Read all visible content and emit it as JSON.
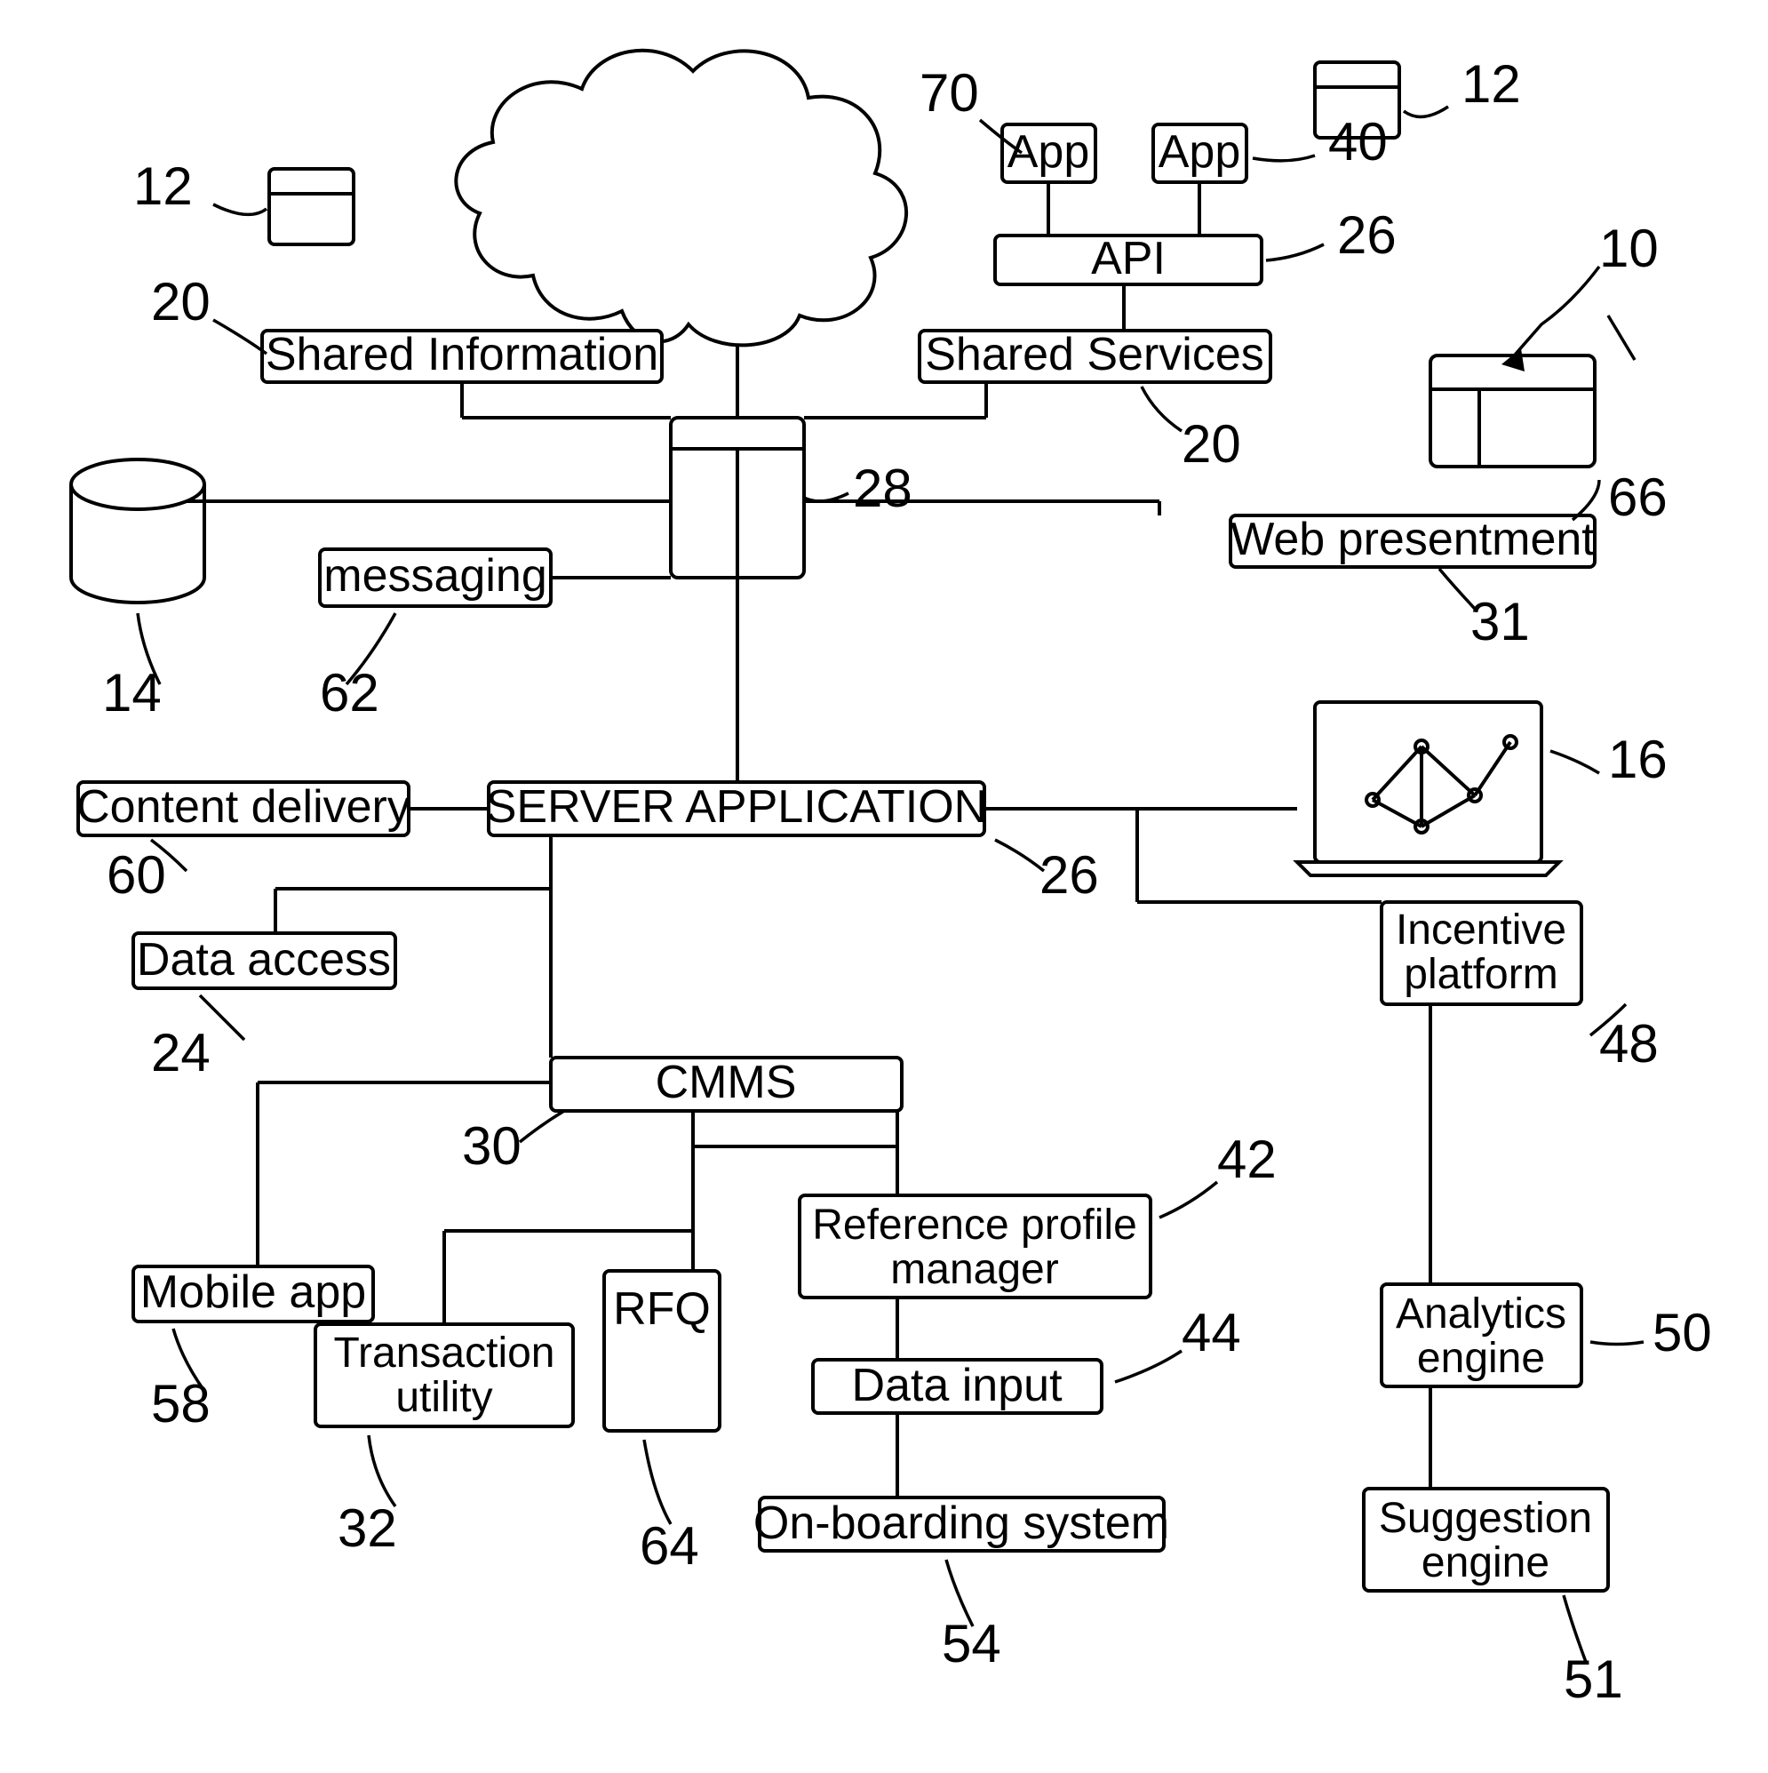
{
  "blocks": {
    "app1": "App",
    "app2": "App",
    "api": "API",
    "shared_info": "Shared Information",
    "shared_services": "Shared Services",
    "messaging": "messaging",
    "web_presentment": "Web presentment",
    "content_delivery": "Content delivery",
    "server_application": "SERVER APPLICATION",
    "data_access": "Data access",
    "incentive_platform": "Incentive platform",
    "cmms": "CMMS",
    "reference_profile_manager_l1": "Reference profile",
    "reference_profile_manager_l2": "manager",
    "mobile_app": "Mobile app",
    "transaction_utility_l1": "Transaction",
    "transaction_utility_l2": "utility",
    "rfq": "RFQ",
    "data_input": "Data input",
    "analytics_engine_l1": "Analytics",
    "analytics_engine_l2": "engine",
    "on_boarding": "On-boarding system",
    "suggestion_engine_l1": "Suggestion",
    "suggestion_engine_l2": "engine"
  },
  "refs": {
    "r10": "10",
    "r12a": "12",
    "r12b": "12",
    "r14": "14",
    "r16": "16",
    "r20a": "20",
    "r20b": "20",
    "r24": "24",
    "r26a": "26",
    "r26b": "26",
    "r28": "28",
    "r30": "30",
    "r31": "31",
    "r32": "32",
    "r40": "40",
    "r42": "42",
    "r44": "44",
    "r48": "48",
    "r50": "50",
    "r51": "51",
    "r54": "54",
    "r58": "58",
    "r60": "60",
    "r62": "62",
    "r64": "64",
    "r66": "66",
    "r70": "70"
  }
}
